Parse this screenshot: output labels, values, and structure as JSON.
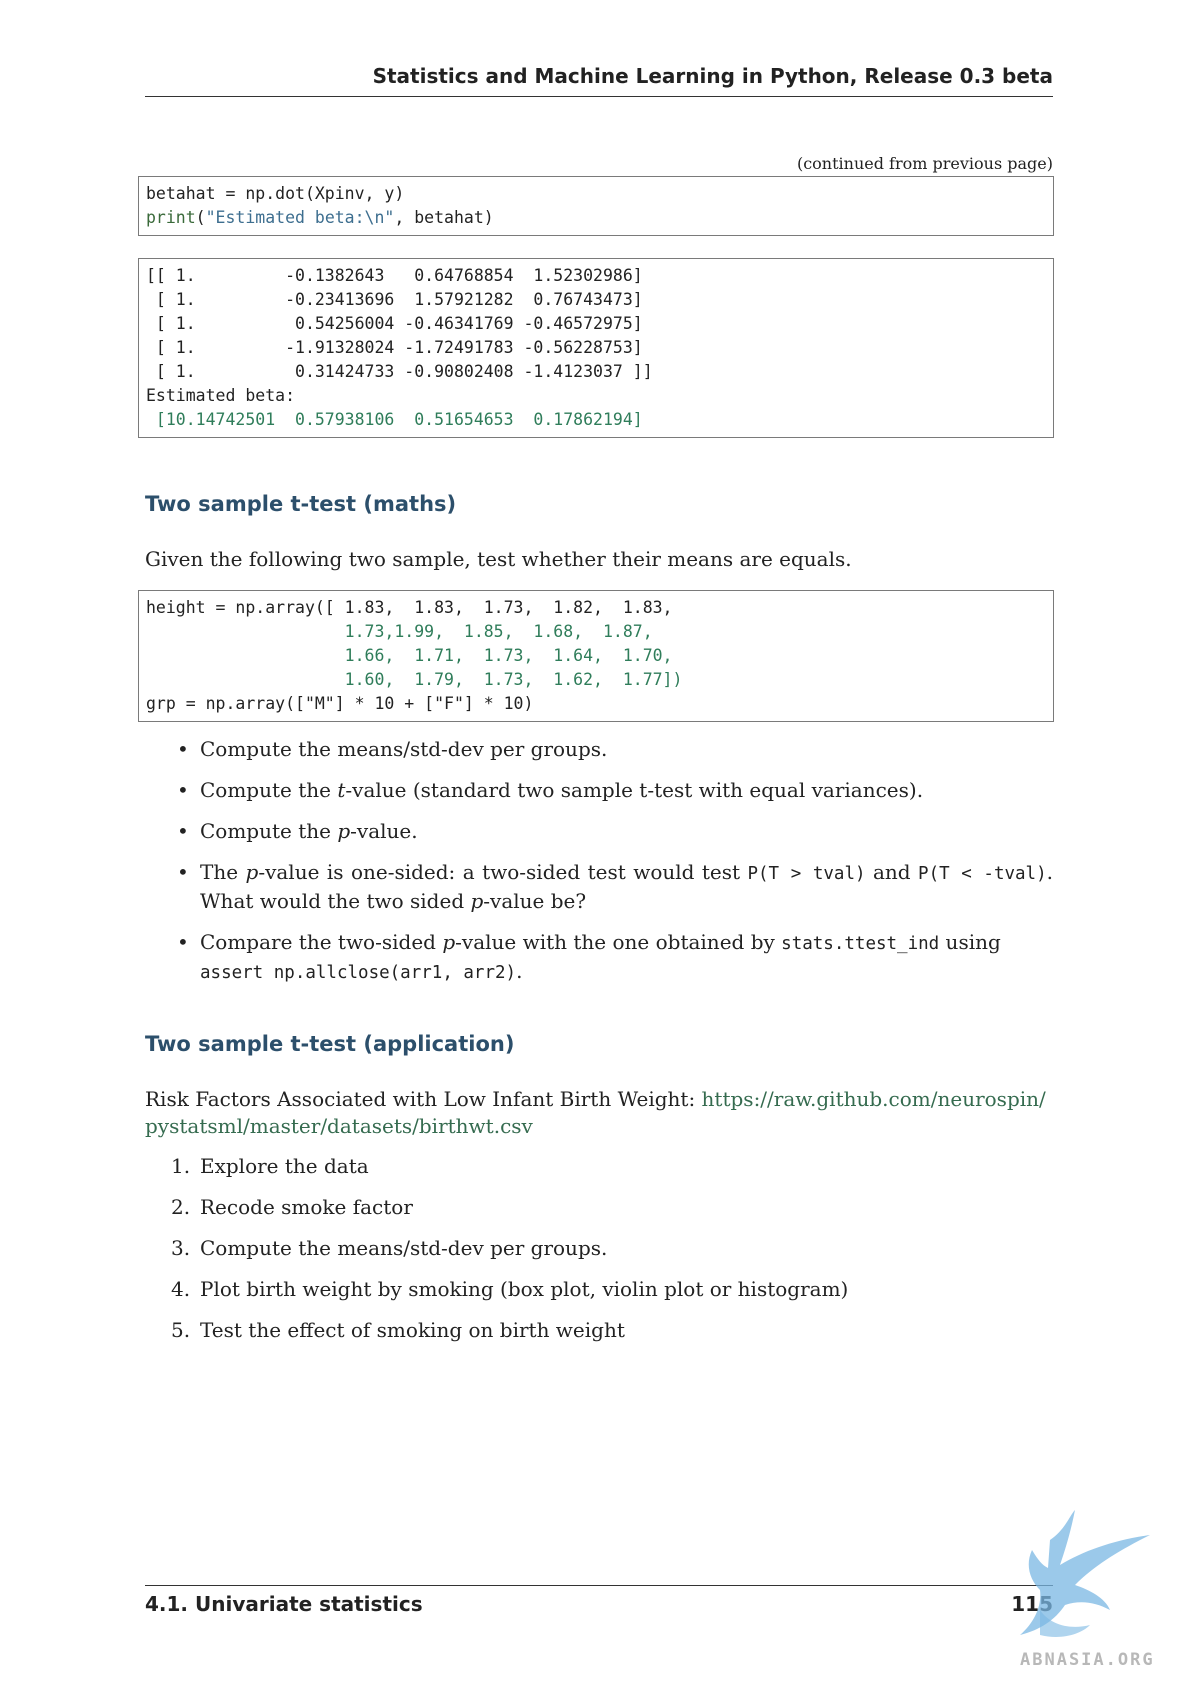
{
  "header": {
    "title": "Statistics and Machine Learning in Python, Release 0.3 beta"
  },
  "continued": "(continued from previous page)",
  "code1": {
    "line1": "betahat = np.dot(Xpinv, y)",
    "line2_fn": "print",
    "line2_str": "\"Estimated beta:\\n\"",
    "line2_rest": ", betahat)"
  },
  "output1": {
    "rows": [
      "[[ 1.         -0.1382643   0.64768854  1.52302986]",
      " [ 1.         -0.23413696  1.57921282  0.76743473]",
      " [ 1.          0.54256004 -0.46341769 -0.46572975]",
      " [ 1.         -1.91328024 -1.72491783 -0.56228753]",
      " [ 1.          0.31424733 -0.90802408 -1.4123037 ]]",
      "Estimated beta:",
      " [10.14742501  0.57938106  0.51654653  0.17862194]"
    ]
  },
  "section1": {
    "title": "Two sample t-test (maths)",
    "intro": "Given the following two sample, test whether their means are equals."
  },
  "code2": {
    "lines": [
      "height = np.array([ 1.83,  1.83,  1.73,  1.82,  1.83,",
      "                    1.73,1.99,  1.85,  1.68,  1.87,",
      "                    1.66,  1.71,  1.73,  1.64,  1.70,",
      "                    1.60,  1.79,  1.73,  1.62,  1.77])",
      "grp = np.array([\"M\"] * 10 + [\"F\"] * 10)"
    ]
  },
  "bullets": {
    "b1": "Compute the means/std-dev per groups.",
    "b2_pre": "Compute the ",
    "b2_var": "t",
    "b2_post": "-value (standard two sample t-test with equal variances).",
    "b3_pre": "Compute the ",
    "b3_var": "p",
    "b3_post": "-value.",
    "b4_pre": "The ",
    "b4_var": "p",
    "b4_mid": "-value is one-sided: a two-sided test would test ",
    "b4_code1": "P(T > tval)",
    "b4_and": " and ",
    "b4_code2": "P(T < -tval)",
    "b4_end": ". What would the two sided ",
    "b4_var2": "p",
    "b4_end2": "-value be?",
    "b5_pre": "Compare the two-sided ",
    "b5_var": "p",
    "b5_mid": "-value with the one obtained by ",
    "b5_code1": "stats.ttest_ind",
    "b5_using": " using ",
    "b5_code2": "assert np.allclose(arr1, arr2)",
    "b5_end": "."
  },
  "section2": {
    "title": "Two sample t-test (application)",
    "intro": "Risk Factors Associated with Low Infant Birth Weight: ",
    "link": "https://raw.github.com/neurospin/pystatsml/master/datasets/birthwt.csv"
  },
  "steps": [
    {
      "n": "1.",
      "text": "Explore the data"
    },
    {
      "n": "2.",
      "text": "Recode smoke factor"
    },
    {
      "n": "3.",
      "text": "Compute the means/std-dev per groups."
    },
    {
      "n": "4.",
      "text": "Plot birth weight by smoking (box plot, violin plot or histogram)"
    },
    {
      "n": "5.",
      "text": "Test the effect of smoking on birth weight"
    }
  ],
  "footer": {
    "section": "4.1.  Univariate statistics",
    "page": "115"
  },
  "watermark": {
    "text": "ABNASIA.ORG"
  }
}
